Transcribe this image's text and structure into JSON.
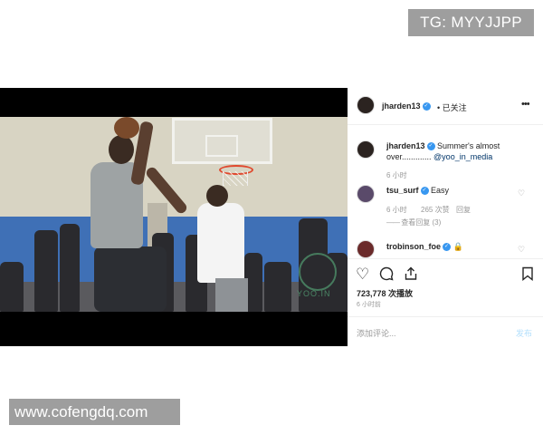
{
  "watermarks": {
    "top": "TG: MYYJJPP",
    "bottom": "www.cofengdq.com"
  },
  "media": {
    "overlay_logo_text": "YOO.IN",
    "user_tag_icon": "user-icon"
  },
  "post": {
    "author": "jharden13",
    "follow_status": "• 已关注",
    "more_icon": "more-horizontal-icon",
    "caption": {
      "author": "jharden13",
      "text": "Summer's almost over.............",
      "mention": "@yoo_in_media",
      "time": "6 小时"
    },
    "comments": [
      {
        "user": "tsu_surf",
        "text": "Easy",
        "time": "6 小时",
        "likes": "265 次赞",
        "reply": "回复",
        "view_replies": "查看回复 (3)"
      },
      {
        "user": "trobinson_foe",
        "text": "🔒"
      }
    ],
    "actions": {
      "like_icon": "heart-icon",
      "comment_icon": "comment-icon",
      "share_icon": "share-icon",
      "save_icon": "bookmark-icon"
    },
    "likes": "723,778 次播放",
    "posted": "6 小时前",
    "comment_placeholder": "添加评论...",
    "post_button": "发布"
  },
  "colors": {
    "accent_blue": "#3897f0",
    "link_blue": "#003569",
    "muted_text": "#999999"
  }
}
